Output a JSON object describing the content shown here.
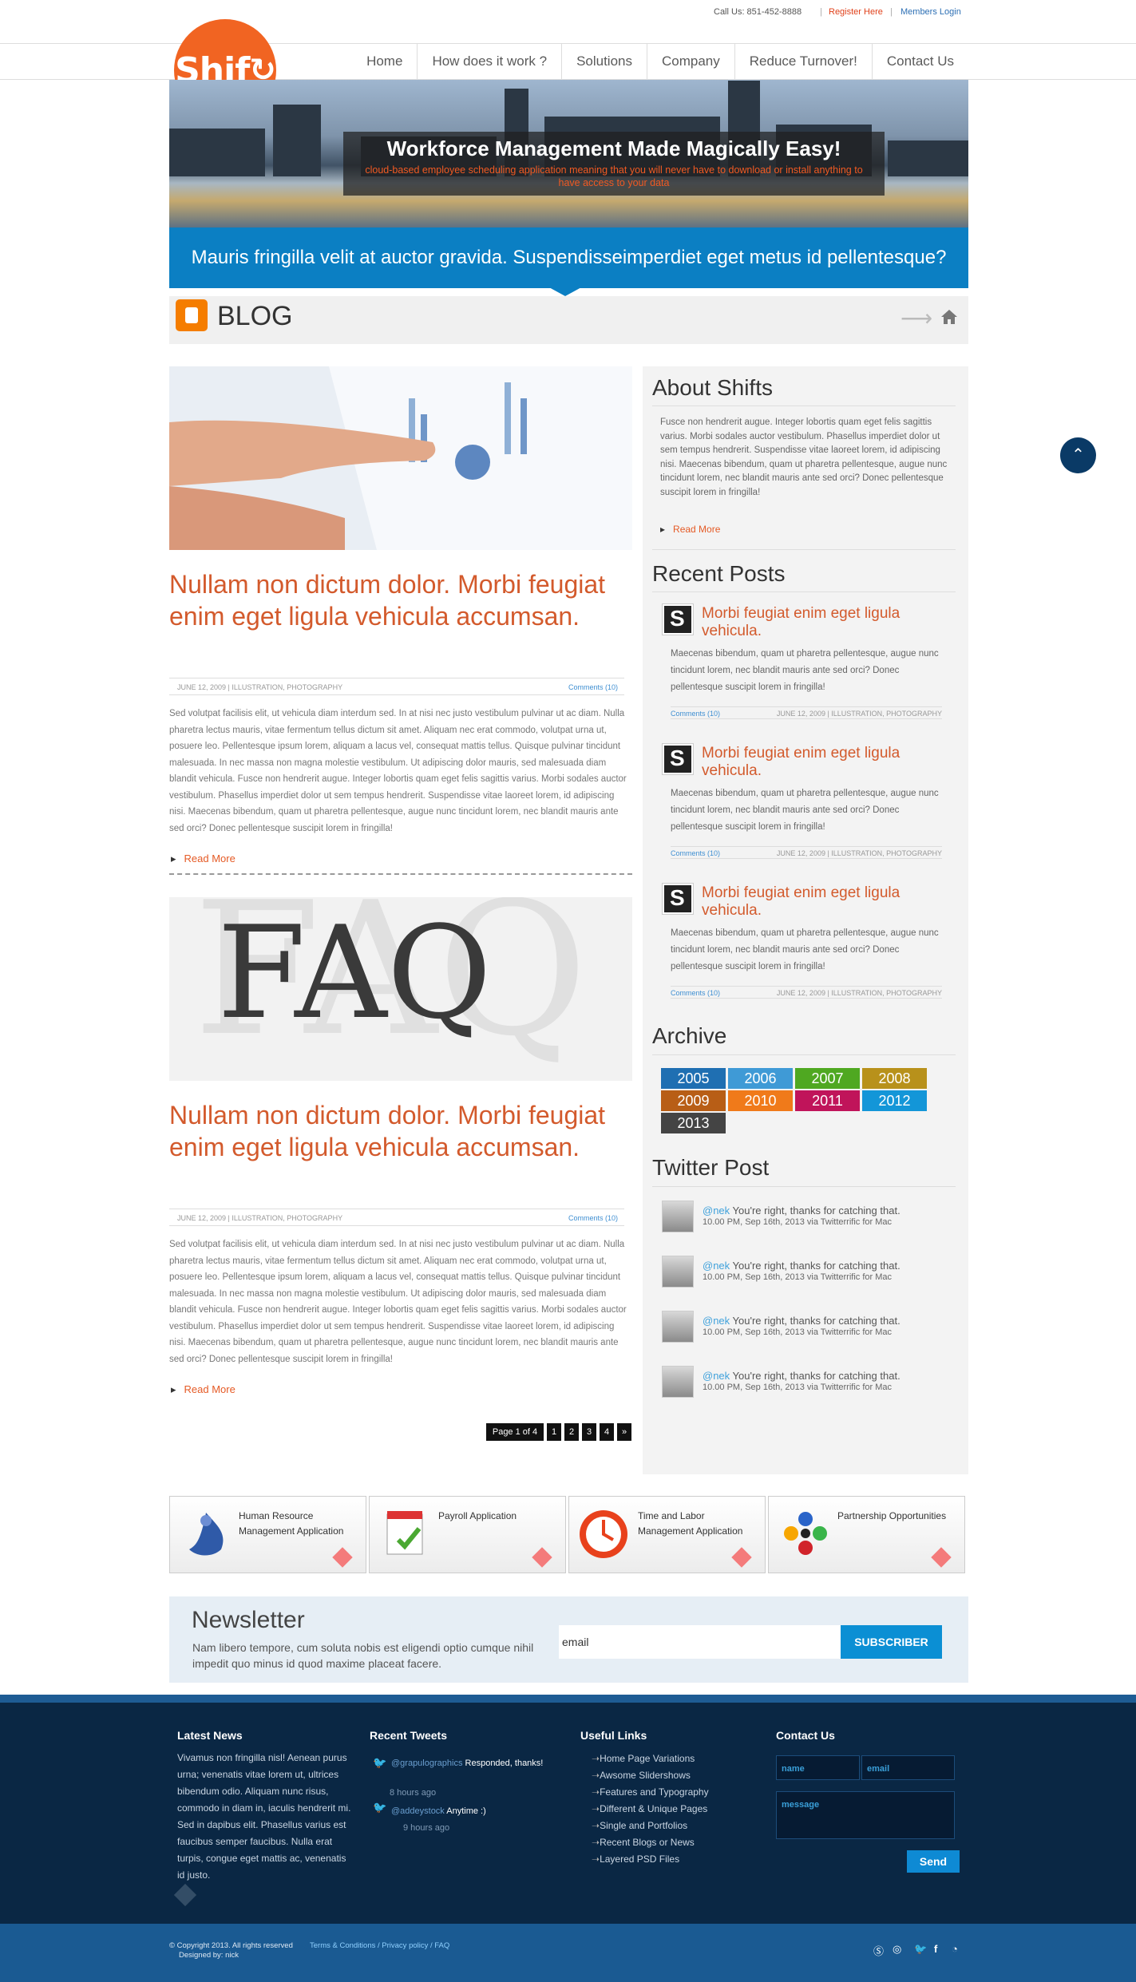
{
  "topbar": {
    "phone": "Call Us: 851-452-8888",
    "register": "Register Here",
    "members": "Members Login",
    "sep": "|"
  },
  "logo": {
    "text": "Shif",
    "brand_color": "#f16422"
  },
  "nav": [
    "Home",
    "How does it work ?",
    "Solutions",
    "Company",
    "Reduce Turnover!",
    "Contact Us"
  ],
  "hero": {
    "title": "Workforce Management Made Magically Easy!",
    "subtitle": "cloud-based employee scheduling application meaning that you will never have to download or install anything to have access to your data"
  },
  "banner": "Mauris fringilla velit at auctor gravida. Suspendisseimperdiet eget metus id pellentesque?",
  "blog": {
    "title": "BLOG",
    "arrow_icon": "arrow-right-icon",
    "home_icon": "home-icon"
  },
  "posts": [
    {
      "title": "Nullam non dictum dolor. Morbi feugiat enim eget ligula vehicula accumsan.",
      "meta": "JUNE 12, 2009 | ILLUSTRATION, PHOTOGRAPHY",
      "comments": "Comments (10)",
      "excerpt": "Sed volutpat facilisis elit, ut vehicula diam interdum sed. In at nisi nec justo vestibulum pulvinar ut ac diam. Nulla pharetra lectus mauris, vitae fermentum tellus dictum sit amet. Aliquam nec erat commodo, volutpat urna ut, posuere leo. Pellentesque ipsum lorem, aliquam a lacus vel, consequat mattis tellus. Quisque pulvinar tincidunt malesuada. In nec massa non magna molestie vestibulum. Ut adipiscing dolor mauris, sed malesuada diam blandit vehicula. Fusce non hendrerit augue. Integer lobortis quam eget felis sagittis varius. Morbi sodales auctor vestibulum. Phasellus imperdiet dolor ut sem tempus hendrerit. Suspendisse vitae laoreet lorem, id adipiscing nisi. Maecenas bibendum, quam ut pharetra pellentesque, augue nunc tincidunt lorem, nec blandit mauris ante sed orci? Donec pellentesque suscipit lorem in fringilla!",
      "read_more": "Read More"
    },
    {
      "title": "Nullam non dictum dolor. Morbi feugiat enim eget ligula vehicula accumsan.",
      "image_text": "FAQ",
      "meta": "JUNE 12, 2009 | ILLUSTRATION, PHOTOGRAPHY",
      "comments": "Comments (10)",
      "excerpt": "Sed volutpat facilisis elit, ut vehicula diam interdum sed. In at nisi nec justo vestibulum pulvinar ut ac diam. Nulla pharetra lectus mauris, vitae fermentum tellus dictum sit amet. Aliquam nec erat commodo, volutpat urna ut, posuere leo. Pellentesque ipsum lorem, aliquam a lacus vel, consequat mattis tellus. Quisque pulvinar tincidunt malesuada. In nec massa non magna molestie vestibulum. Ut adipiscing dolor mauris, sed malesuada diam blandit vehicula. Fusce non hendrerit augue. Integer lobortis quam eget felis sagittis varius. Morbi sodales auctor vestibulum. Phasellus imperdiet dolor ut sem tempus hendrerit. Suspendisse vitae laoreet lorem, id adipiscing nisi. Maecenas bibendum, quam ut pharetra pellentesque, augue nunc tincidunt lorem, nec blandit mauris ante sed orci? Donec pellentesque suscipit lorem in fringilla!",
      "read_more": "Read More"
    }
  ],
  "pagination": {
    "label": "Page 1 of 4",
    "pages": [
      "1",
      "2",
      "3",
      "4"
    ],
    "next": "»"
  },
  "sidebar": {
    "about": {
      "title": "About Shifts",
      "text": "Fusce non hendrerit augue. Integer lobortis quam eget felis sagittis varius. Morbi sodales auctor vestibulum. Phasellus imperdiet dolor ut sem tempus hendrerit. Suspendisse vitae laoreet lorem, id adipiscing nisi. Maecenas bibendum, quam ut pharetra pellentesque, augue nunc tincidunt lorem, nec blandit mauris ante sed orci? Donec pellentesque suscipit lorem in fringilla!",
      "read_more": "Read More"
    },
    "recent": {
      "title": "Recent Posts",
      "items": [
        {
          "thumb": "S",
          "title": "Morbi feugiat enim eget ligula vehicula.",
          "text": "Maecenas bibendum, quam ut pharetra pellentesque, augue nunc tincidunt lorem, nec blandit mauris ante sed orci? Donec pellentesque suscipit lorem in fringilla!",
          "comments": "Comments (10)",
          "meta": "JUNE 12, 2009 | ILLUSTRATION, PHOTOGRAPHY"
        },
        {
          "thumb": "S",
          "title": "Morbi feugiat enim eget ligula vehicula.",
          "text": "Maecenas bibendum, quam ut pharetra pellentesque, augue nunc tincidunt lorem, nec blandit mauris ante sed orci? Donec pellentesque suscipit lorem in fringilla!",
          "comments": "Comments (10)",
          "meta": "JUNE 12, 2009 | ILLUSTRATION, PHOTOGRAPHY"
        },
        {
          "thumb": "S",
          "title": "Morbi feugiat enim eget ligula vehicula.",
          "text": "Maecenas bibendum, quam ut pharetra pellentesque, augue nunc tincidunt lorem, nec blandit mauris ante sed orci? Donec pellentesque suscipit lorem in fringilla!",
          "comments": "Comments (10)",
          "meta": "JUNE 12, 2009 | ILLUSTRATION, PHOTOGRAPHY"
        }
      ]
    },
    "archive": {
      "title": "Archive",
      "years": [
        {
          "year": "2005",
          "color": "#1f6fb2"
        },
        {
          "year": "2006",
          "color": "#3f9ad6"
        },
        {
          "year": "2007",
          "color": "#4fa821"
        },
        {
          "year": "2008",
          "color": "#b8911b"
        },
        {
          "year": "2009",
          "color": "#b85e16"
        },
        {
          "year": "2010",
          "color": "#f07a1a"
        },
        {
          "year": "2011",
          "color": "#c0145a"
        },
        {
          "year": "2012",
          "color": "#1396d8"
        },
        {
          "year": "2013",
          "color": "#444444"
        }
      ]
    },
    "twitter": {
      "title": "Twitter Post",
      "items": [
        {
          "user": "@nek",
          "text": " You're right, thanks for catching that.",
          "time": "10.00 PM, Sep 16th, 2013 via Twitterrific for Mac"
        },
        {
          "user": "@nek",
          "text": " You're right, thanks for catching that.",
          "time": "10.00 PM, Sep 16th, 2013 via Twitterrific for Mac"
        },
        {
          "user": "@nek",
          "text": " You're right, thanks for catching that.",
          "time": "10.00 PM, Sep 16th, 2013 via Twitterrific for Mac"
        },
        {
          "user": "@nek",
          "text": " You're right, thanks for catching that.",
          "time": "10.00 PM, Sep 16th, 2013 via Twitterrific for Mac"
        }
      ]
    }
  },
  "services": [
    {
      "title": "Human Resource Management Application",
      "icon": "hr-icon"
    },
    {
      "title": "Payroll Application",
      "icon": "payroll-icon"
    },
    {
      "title": "Time and Labor Management Application",
      "icon": "clock-icon"
    },
    {
      "title": "Partnership Opportunities",
      "icon": "partnership-icon"
    }
  ],
  "newsletter": {
    "title": "Newsletter",
    "text": "Nam libero tempore, cum soluta nobis est eligendi optio cumque nihil impedit quo minus id quod maxime placeat facere.",
    "email_value": "email",
    "button": "SUBSCRIBER"
  },
  "footer": {
    "latest": {
      "title": "Latest News",
      "text": "Vivamus non fringilla nisl! Aenean purus urna; venenatis vitae lorem ut, ultrices bibendum odio. Aliquam nunc risus, commodo in diam in, iaculis hendrerit mi. Sed in dapibus elit. Phasellus varius est faucibus semper faucibus. Nulla erat turpis, congue eget mattis ac, venenatis id justo."
    },
    "tweets": {
      "title": "Recent Tweets",
      "items": [
        {
          "user": "@grapulographics",
          "text": "Responded, thanks!",
          "time": "8 hours ago"
        },
        {
          "user": "@addeystock",
          "text": "Anytime :)",
          "time": "9 hours ago"
        }
      ]
    },
    "links": {
      "title": "Useful Links",
      "items": [
        "Home Page Variations",
        "Awsome Slidershows",
        "Features and Typography",
        "Different & Unique Pages",
        "Single and Portfolios",
        "Recent Blogs or News",
        "Layered PSD Files"
      ]
    },
    "contact": {
      "title": "Contact Us",
      "name_placeholder": "name",
      "email_placeholder": "email",
      "message_placeholder": "message",
      "send": "Send"
    }
  },
  "copyright": {
    "text": "© Copyright 2013. All rights reserved",
    "designed": "Designed by: nick",
    "links": "Terms & Conditions / Privacy policy / FAQ",
    "social": [
      "skype-icon",
      "dribbble-icon",
      "twitter-icon",
      "facebook-icon",
      "rss-icon"
    ]
  }
}
